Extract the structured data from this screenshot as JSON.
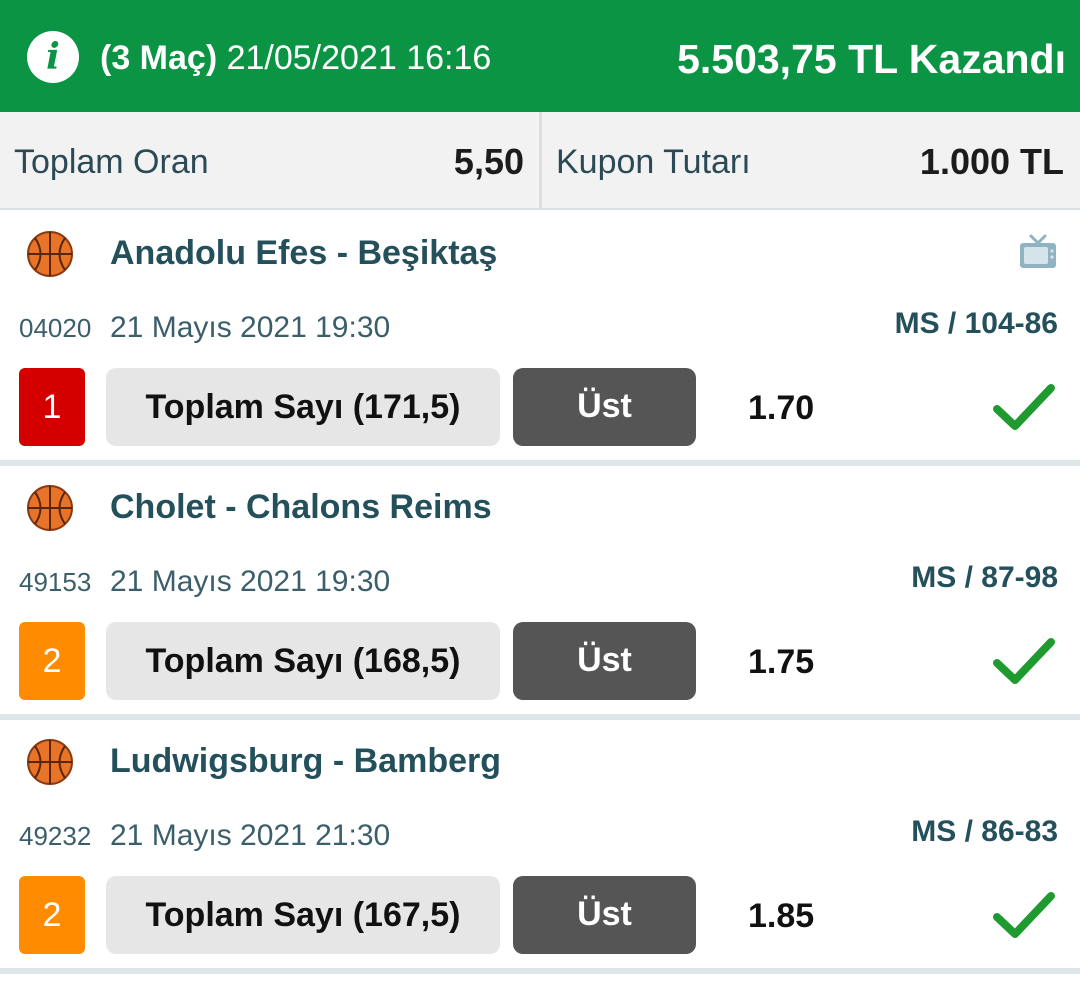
{
  "header": {
    "match_count": "(3 Maç)",
    "datetime": "21/05/2021 16:16",
    "winnings": "5.503,75 TL Kazandı",
    "bg_color": "#0b9444",
    "info_icon": "i"
  },
  "summary": {
    "total_odds_label": "Toplam Oran",
    "total_odds_value": "5,50",
    "stake_label": "Kupon Tutarı",
    "stake_value": "1.000 TL"
  },
  "matches": [
    {
      "title": "Anadolu Efes - Beşiktaş",
      "code": "04020",
      "date": "21 Mayıs 2021 19:30",
      "result": "MS / 104-86",
      "pick": "1",
      "pick_color": "#d40000",
      "market": "Toplam Sayı (171,5)",
      "selection": "Üst",
      "odds": "1.70",
      "has_tv": true,
      "status": "won"
    },
    {
      "title": "Cholet - Chalons Reims",
      "code": "49153",
      "date": "21 Mayıs 2021 19:30",
      "result": "MS / 87-98",
      "pick": "2",
      "pick_color": "#ff8c00",
      "market": "Toplam Sayı (168,5)",
      "selection": "Üst",
      "odds": "1.75",
      "has_tv": false,
      "status": "won"
    },
    {
      "title": "Ludwigsburg - Bamberg",
      "code": "49232",
      "date": "21 Mayıs 2021 21:30",
      "result": "MS / 86-83",
      "pick": "2",
      "pick_color": "#ff8c00",
      "market": "Toplam Sayı (167,5)",
      "selection": "Üst",
      "odds": "1.85",
      "has_tv": false,
      "status": "won"
    }
  ],
  "icons": {
    "sport": "basketball-icon",
    "tv": "tv-icon",
    "status": "checkmark-icon"
  }
}
